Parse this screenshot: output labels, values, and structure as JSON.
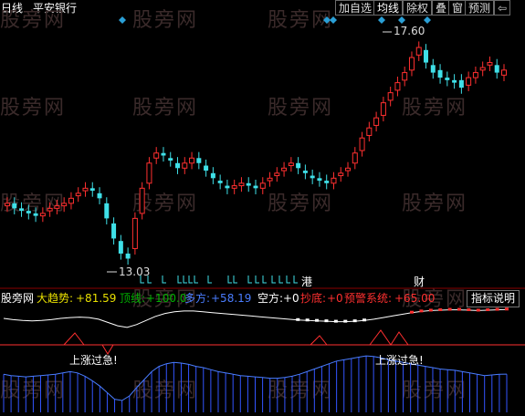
{
  "window": {
    "title": "日线 · 平安银行"
  },
  "header": {
    "period": "日线",
    "stock_name": "平安银行"
  },
  "toolbar": [
    {
      "label": "加自选"
    },
    {
      "label": "均线"
    },
    {
      "label": "除权"
    },
    {
      "label": "叠"
    },
    {
      "label": "窗"
    },
    {
      "label": "预测"
    },
    {
      "label": "⇦"
    }
  ],
  "price_marks": {
    "high": "17.60",
    "low": "13.03"
  },
  "event_marks": {
    "port": "港",
    "fin": "财"
  },
  "watermark": "股旁网",
  "indicator_bar": {
    "site": "股旁网",
    "items": [
      {
        "label": "大趋势:",
        "value": "+81.59",
        "color": "#e8e000"
      },
      {
        "label": "顶线:",
        "value": "+100.0",
        "color": "#00b000"
      },
      {
        "label": "多方:",
        "value": "+58.19",
        "color": "#4a7dff"
      },
      {
        "label": "空方:",
        "value": "+0",
        "color": "#ffffff"
      },
      {
        "label": "抄底:",
        "value": "+0",
        "color": "#ff3030"
      },
      {
        "label": "预警系统:",
        "value": "+65.00",
        "color": "#ff3030"
      }
    ],
    "help_label": "指标说明"
  },
  "annotations": {
    "rise_left": "上涨过急!",
    "rise_right": "上涨过急!"
  },
  "colors": {
    "up": "#ff3030",
    "down": "#3fe0e8",
    "accent": "#2a9fd6",
    "lower_bars": "#3355ff"
  },
  "chart_data": [
    {
      "type": "candlestick",
      "title": "",
      "ylabel": "",
      "high_label": 17.6,
      "low_label": 13.03,
      "close": [
        14.3,
        14.2,
        14.15,
        14.1,
        14.05,
        14.1,
        14.2,
        14.25,
        14.3,
        14.4,
        14.5,
        14.6,
        14.55,
        14.4,
        14.0,
        13.6,
        13.3,
        13.2,
        14.0,
        14.6,
        15.1,
        15.3,
        15.25,
        15.15,
        15.0,
        15.1,
        15.2,
        15.1,
        14.95,
        14.8,
        14.7,
        14.6,
        14.65,
        14.7,
        14.65,
        14.6,
        14.7,
        14.8,
        14.9,
        15.0,
        15.1,
        15.0,
        14.9,
        14.8,
        14.75,
        14.7,
        14.8,
        14.9,
        15.0,
        15.3,
        15.6,
        15.8,
        16.0,
        16.3,
        16.5,
        16.7,
        16.9,
        17.2,
        17.4,
        17.1,
        16.9,
        16.8,
        16.75,
        16.7,
        16.6,
        16.8,
        16.9,
        17.0,
        17.1,
        16.9,
        16.95
      ],
      "open": [
        14.25,
        14.3,
        14.2,
        14.15,
        14.1,
        14.05,
        14.15,
        14.2,
        14.25,
        14.3,
        14.45,
        14.55,
        14.6,
        14.5,
        14.3,
        13.9,
        13.55,
        13.3,
        13.4,
        14.1,
        14.7,
        15.2,
        15.3,
        15.2,
        15.1,
        15.0,
        15.1,
        15.2,
        15.05,
        14.9,
        14.75,
        14.65,
        14.6,
        14.65,
        14.7,
        14.65,
        14.6,
        14.75,
        14.85,
        14.95,
        15.05,
        15.1,
        14.95,
        14.85,
        14.8,
        14.75,
        14.7,
        14.85,
        14.95,
        15.1,
        15.35,
        15.65,
        15.85,
        16.05,
        16.35,
        16.55,
        16.75,
        16.95,
        17.25,
        17.35,
        17.05,
        16.95,
        16.8,
        16.75,
        16.75,
        16.65,
        16.8,
        16.95,
        17.05,
        17.05,
        16.85
      ]
    },
    {
      "type": "line",
      "title": "",
      "series": [
        {
          "name": "大趋势",
          "values": [
            60,
            57,
            55,
            54,
            55,
            57,
            60,
            62,
            63,
            62,
            58,
            50,
            42,
            38,
            45,
            55,
            65,
            72,
            76,
            78,
            78,
            76,
            74,
            72,
            70,
            68,
            66,
            64,
            62,
            60,
            58,
            56,
            55,
            54,
            53,
            52,
            52,
            53,
            55,
            58,
            62,
            66,
            70,
            74,
            77,
            79,
            80,
            81,
            81,
            80,
            79,
            80,
            81,
            81.59
          ]
        }
      ]
    },
    {
      "type": "bar",
      "title": "",
      "series": [
        {
          "name": "多方",
          "values": [
            58,
            56,
            55,
            54,
            55,
            56,
            57,
            58,
            60,
            62,
            60,
            55,
            48,
            40,
            30,
            20,
            18,
            25,
            38,
            50,
            62,
            70,
            74,
            76,
            75,
            73,
            70,
            68,
            65,
            62,
            60,
            58,
            56,
            55,
            54,
            53,
            52,
            52,
            53,
            55,
            58,
            62,
            66,
            70,
            74,
            78,
            80,
            82,
            84,
            86,
            85,
            83,
            80,
            78,
            76,
            74,
            72,
            70,
            68,
            66,
            65,
            64,
            62,
            60,
            58,
            56,
            57,
            58,
            58.19
          ]
        }
      ]
    }
  ]
}
